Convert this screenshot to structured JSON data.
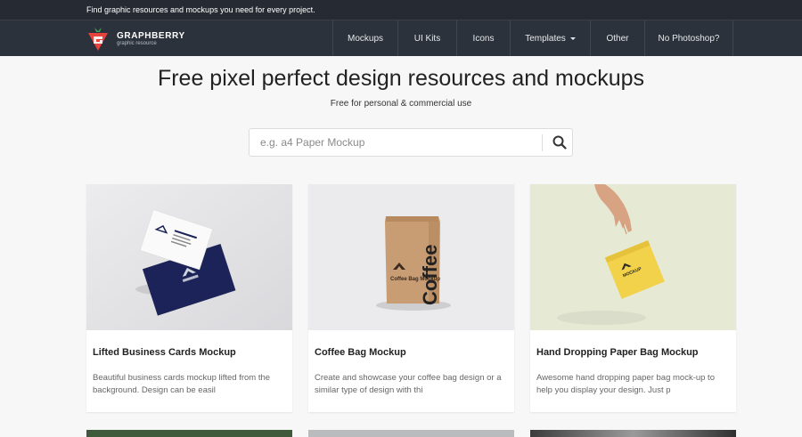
{
  "topbar": {
    "text": "Find graphic resources and mockups you need for every project."
  },
  "brand": {
    "name": "GRAPHBERRY",
    "tagline": "graphic resource"
  },
  "nav": {
    "items": [
      {
        "label": "Mockups"
      },
      {
        "label": "UI Kits"
      },
      {
        "label": "Icons"
      },
      {
        "label": "Templates"
      },
      {
        "label": "Other"
      },
      {
        "label": "No Photoshop?"
      }
    ]
  },
  "hero": {
    "title": "Free pixel perfect design resources and mockups",
    "subtitle": "Free for personal & commercial use"
  },
  "search": {
    "placeholder": "e.g. a4 Paper Mockup",
    "value": "",
    "icon": "search-icon"
  },
  "cards": [
    {
      "title": "Lifted Business Cards Mockup",
      "description": "Beautiful business cards mockup lifted from the background. Design can be easil"
    },
    {
      "title": "Coffee Bag Mockup",
      "description": "Create and showcase your coffee bag design or a similar type of design with thi",
      "bag_label": "Coffee Bag Mockup",
      "bag_side": "Coffee"
    },
    {
      "title": "Hand Dropping Paper Bag Mockup",
      "description": "Awesome hand dropping paper bag mock-up to help you display your design. Just p",
      "bag_label": "MOCKUP"
    }
  ],
  "colors": {
    "topbar_bg": "#262b33",
    "navbar_bg": "#2c323b",
    "brand_red": "#e8423c",
    "brand_green": "#3aa655",
    "page_bg": "#f7f7f7"
  }
}
